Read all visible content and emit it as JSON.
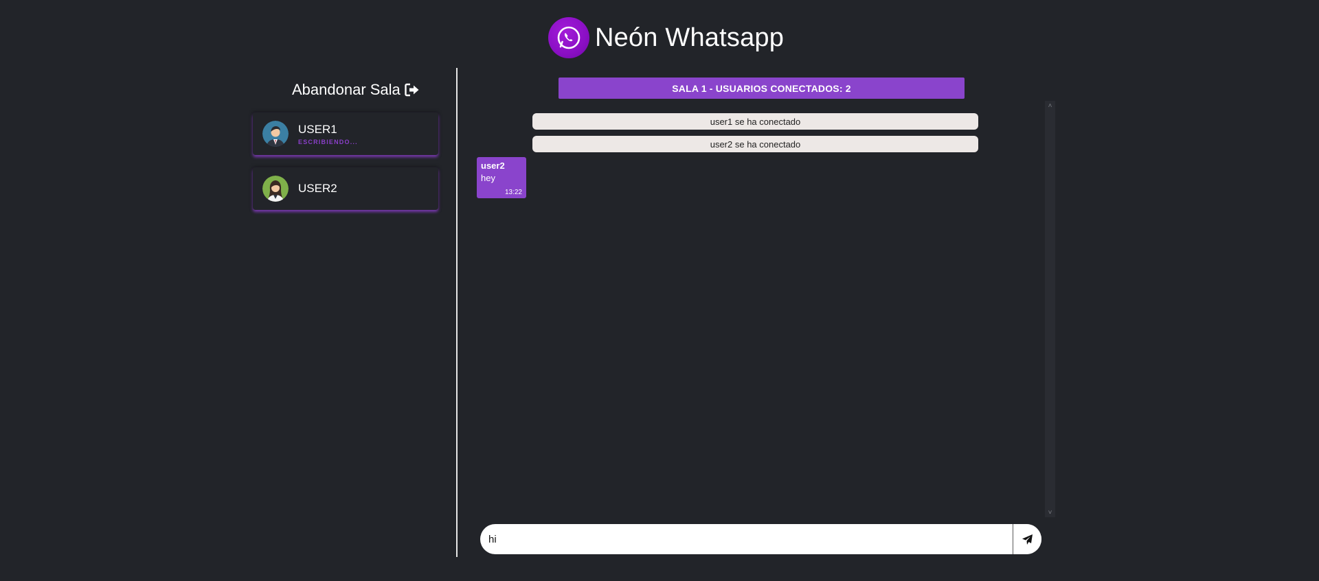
{
  "header": {
    "title": "Neón Whatsapp",
    "logo_icon": "whatsapp-phone-icon",
    "logo_color": "#8a0fc4"
  },
  "sidebar": {
    "leave_label": "Abandonar Sala",
    "leave_icon": "sign-out-icon",
    "users": [
      {
        "name": "USER1",
        "status": "ESCRIBIENDO...",
        "avatar": "male-avatar-icon"
      },
      {
        "name": "USER2",
        "status": "",
        "avatar": "female-avatar-icon"
      }
    ]
  },
  "chat": {
    "banner": "SALA 1 - USUARIOS CONECTADOS: 2",
    "system_messages": [
      "user1 se ha conectado",
      "user2 se ha conectado"
    ],
    "messages": [
      {
        "author": "user2",
        "text": "hey",
        "time": "13:22"
      }
    ]
  },
  "composer": {
    "value": "hi",
    "send_icon": "paper-plane-icon"
  },
  "colors": {
    "accent": "#8a44cc",
    "background": "#222429",
    "system_bubble": "#ede8e6"
  }
}
